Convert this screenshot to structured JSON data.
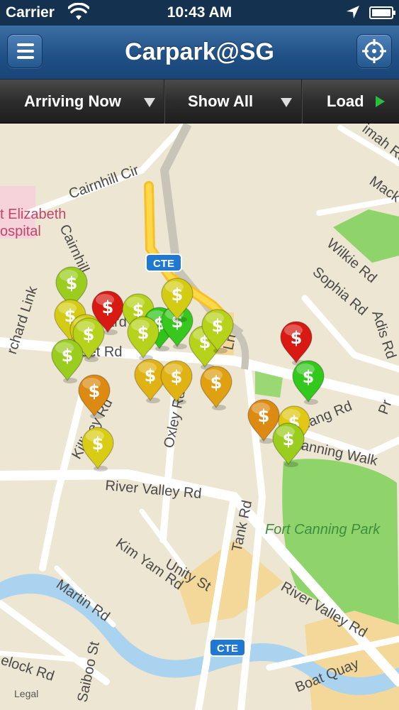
{
  "status_bar": {
    "carrier": "Carrier",
    "time": "10:43 AM"
  },
  "nav": {
    "title": "Carpark@SG",
    "menu_icon": "hamburger-menu-icon",
    "locate_icon": "crosshair-locate-icon"
  },
  "toolbar": {
    "arriving_label": "Arriving Now",
    "filter_label": "Show All",
    "load_label": "Load"
  },
  "map": {
    "legal": "Legal",
    "highway_shield": "CTE",
    "poi_line1": "t Elizabeth",
    "poi_line2": "ospital",
    "park": "Fort Canning Park",
    "roads": {
      "cairnhill_cir": "Cairnhill Cir",
      "cairnhill": "Cairnhill",
      "orchard_link": "rchard Link",
      "somerset_rd": "rset Rd",
      "killiney_rd": "Killiney Rd",
      "oxley_rd": "Oxley Rd",
      "river_valley_rd_1": "River Valley Rd",
      "river_valley_rd_2": "River Valley Rd",
      "tank_rd": "Tank Rd",
      "kim_yam_rd": "Kim Yam Rd",
      "unity_st": "Unity St",
      "martin_rd": "Martin Rd",
      "saiboo_st": "Saiboo St",
      "havelock_rd": "elock Rd",
      "boat_quay": "Boat Quay",
      "canning_walk": "Canning Walk",
      "penang_rd": "nang Rd",
      "wilkie_rd": "Wilkie Rd",
      "sophia_rd": "Sophia Rd",
      "adis_rd": "Adis Rd",
      "mack": "Mack",
      "selegie": "imah Rd",
      "ln": "Ln",
      "pr": "Pr",
      "rd_frag": "ard"
    },
    "pin_symbol": "$",
    "pins": [
      {
        "name": "pin-01",
        "status": "yellow-green",
        "color": "#9acd1e"
      },
      {
        "name": "pin-02",
        "status": "red",
        "color": "#d81a12"
      },
      {
        "name": "pin-03",
        "status": "yellow",
        "color": "#d4cc14"
      },
      {
        "name": "pin-04",
        "status": "yellow",
        "color": "#d4cc14"
      },
      {
        "name": "pin-05",
        "status": "yellow-green",
        "color": "#b6d21a"
      },
      {
        "name": "pin-06",
        "status": "green",
        "color": "#2fc41a"
      },
      {
        "name": "pin-07",
        "status": "yellow-green",
        "color": "#b6d21a"
      },
      {
        "name": "pin-08",
        "status": "yellow-green",
        "color": "#b6d21a"
      },
      {
        "name": "pin-09",
        "status": "green",
        "color": "#38c81d"
      },
      {
        "name": "pin-10",
        "status": "yellow",
        "color": "#d4cc14"
      },
      {
        "name": "pin-11",
        "status": "yellow-green",
        "color": "#b6d21a"
      },
      {
        "name": "pin-12",
        "status": "yellow-green",
        "color": "#b6d21a"
      },
      {
        "name": "pin-13",
        "status": "yellow-green",
        "color": "#9acd1e"
      },
      {
        "name": "pin-14",
        "status": "red",
        "color": "#d81a12"
      },
      {
        "name": "pin-15",
        "status": "green",
        "color": "#32c81c"
      },
      {
        "name": "pin-16",
        "status": "orange",
        "color": "#dc8a12"
      },
      {
        "name": "pin-17",
        "status": "yellow-orange",
        "color": "#e0b214"
      },
      {
        "name": "pin-18",
        "status": "yellow-orange",
        "color": "#e0b214"
      },
      {
        "name": "pin-19",
        "status": "orange",
        "color": "#e0a012"
      },
      {
        "name": "pin-20",
        "status": "orange",
        "color": "#dc8a12"
      },
      {
        "name": "pin-21",
        "status": "yellow",
        "color": "#e0c814"
      },
      {
        "name": "pin-22",
        "status": "yellow-green",
        "color": "#9acd1e"
      },
      {
        "name": "pin-23",
        "status": "yellow",
        "color": "#d8cc14"
      }
    ]
  }
}
